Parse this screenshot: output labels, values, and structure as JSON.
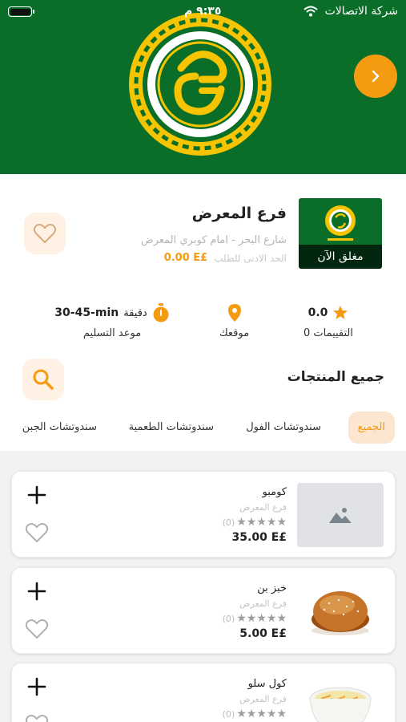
{
  "status_bar": {
    "carrier": "شركة الاتصالات",
    "time": "٩:٣٥ م"
  },
  "branch": {
    "name": "فرع المعرض",
    "address": "شارع البحر - امام كوبري المعرض",
    "min_order_label": "الحد الادنى للطلب",
    "min_order_value": "0.00 E£",
    "status": "مغلق الآن"
  },
  "stats": {
    "rating_value": "0.0",
    "rating_label": "0 التقييمات",
    "location_label": "موقعك",
    "delivery_value": "30-45-min",
    "delivery_unit": "دقيقة",
    "delivery_label": "موعد التسليم"
  },
  "section": {
    "title": "جميع المنتجات"
  },
  "tabs": [
    {
      "label": "الجميع",
      "active": true
    },
    {
      "label": "سندوتشات الفول",
      "active": false
    },
    {
      "label": "سندوتشات الطعمية",
      "active": false
    },
    {
      "label": "سندوتشات الجبن",
      "active": false
    }
  ],
  "products": [
    {
      "name": "كومبو",
      "branch": "فرع المعرض",
      "reviews": "(0)",
      "price": "35.00 E£",
      "image": "placeholder-image-icon"
    },
    {
      "name": "خبز بن",
      "branch": "فرع المعرض",
      "reviews": "(0)",
      "price": "5.00 E£",
      "image": "bun-photo"
    },
    {
      "name": "كول سلو",
      "branch": "فرع المعرض",
      "reviews": "(0)",
      "price": "",
      "image": "coleslaw-photo"
    }
  ],
  "colors": {
    "brand_green": "#0a6e28",
    "accent_orange": "#f49b12",
    "accent_light": "#fff1e3"
  }
}
